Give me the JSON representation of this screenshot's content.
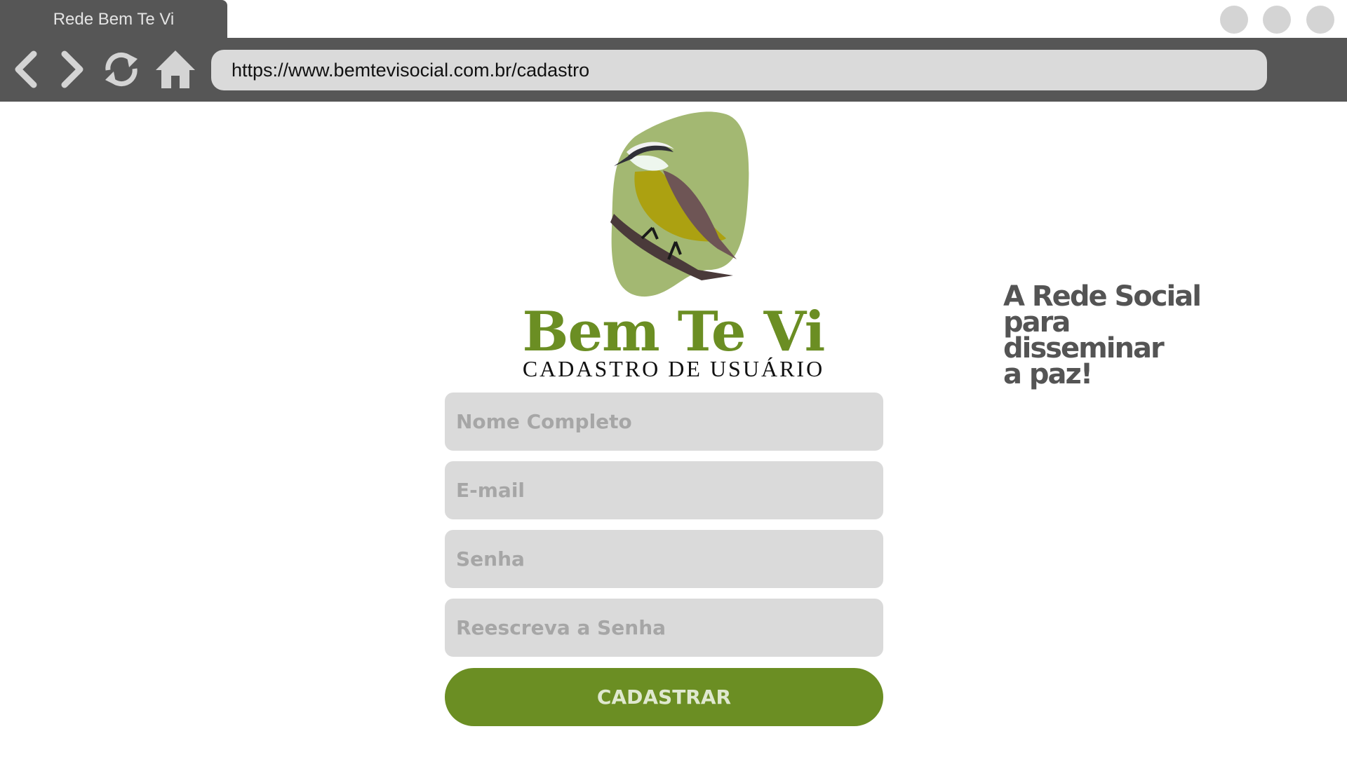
{
  "browser": {
    "tab_title": "Rede Bem Te Vi",
    "url": "https://www.bemtevisocial.com.br/cadastro",
    "icons": [
      "back-icon",
      "forward-icon",
      "reload-icon",
      "home-icon"
    ]
  },
  "brand": {
    "name": "Bem Te Vi",
    "subtitle": "CADASTRO DE USUÁRIO",
    "logo": "bem-te-vi-bird-logo"
  },
  "form": {
    "name_placeholder": "Nome Completo",
    "email_placeholder": "E-mail",
    "password_placeholder": "Senha",
    "password_confirm_placeholder": "Reescreva a Senha",
    "submit_label": "CADASTRAR"
  },
  "tagline": {
    "line1": "A Rede Social",
    "line2": "para",
    "line3": "disseminar",
    "line4": "a paz!"
  },
  "colors": {
    "brand_green": "#6b8e23",
    "chrome_gray": "#565656",
    "field_gray": "#dadada",
    "logo_blob": "#a3b872"
  }
}
